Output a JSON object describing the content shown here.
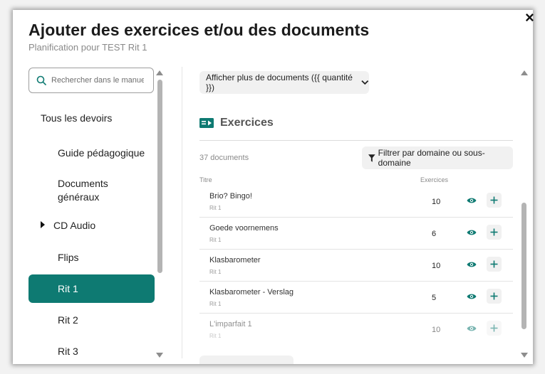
{
  "dialog": {
    "title": "Ajouter des exercices et/ou des documents",
    "subtitle": "Planification pour TEST Rit 1",
    "close_label": "×"
  },
  "search": {
    "placeholder": "Rechercher dans le manuel"
  },
  "nav": {
    "all": "Tous les devoirs",
    "items": [
      {
        "label": "Guide pédagogique"
      },
      {
        "label": "Documents\ngénéraux"
      },
      {
        "label": "CD Audio",
        "expandable": true
      },
      {
        "label": "Flips"
      },
      {
        "label": "Rit 1",
        "active": true
      },
      {
        "label": "Rit 2"
      },
      {
        "label": "Rit 3"
      }
    ]
  },
  "more_docs_label": "Afficher plus de documents ({{ quantité }})",
  "section": {
    "title": "Exercices",
    "count_label": "37 documents",
    "filter_label": "Filtrer par domaine ou sous-domaine",
    "columns": {
      "title": "Titre",
      "exercises": "Exercices"
    },
    "rows": [
      {
        "title": "Brio? Bingo!",
        "sub": "Rit 1",
        "count": "10"
      },
      {
        "title": "Goede voornemens",
        "sub": "Rit 1",
        "count": "6"
      },
      {
        "title": "Klasbarometer",
        "sub": "Rit 1",
        "count": "10"
      },
      {
        "title": "Klasbarometer - Verslag",
        "sub": "Rit 1",
        "count": "5"
      },
      {
        "title": "L'imparfait 1",
        "sub": "Rit 1",
        "count": "10"
      }
    ]
  },
  "colors": {
    "accent": "#0e7a72",
    "button_bg": "#f1f1f1"
  },
  "icons": [
    "close-icon",
    "search-icon",
    "caret-right-icon",
    "chevron-down-icon",
    "book-video-icon",
    "filter-icon",
    "eye-icon",
    "plus-icon"
  ]
}
